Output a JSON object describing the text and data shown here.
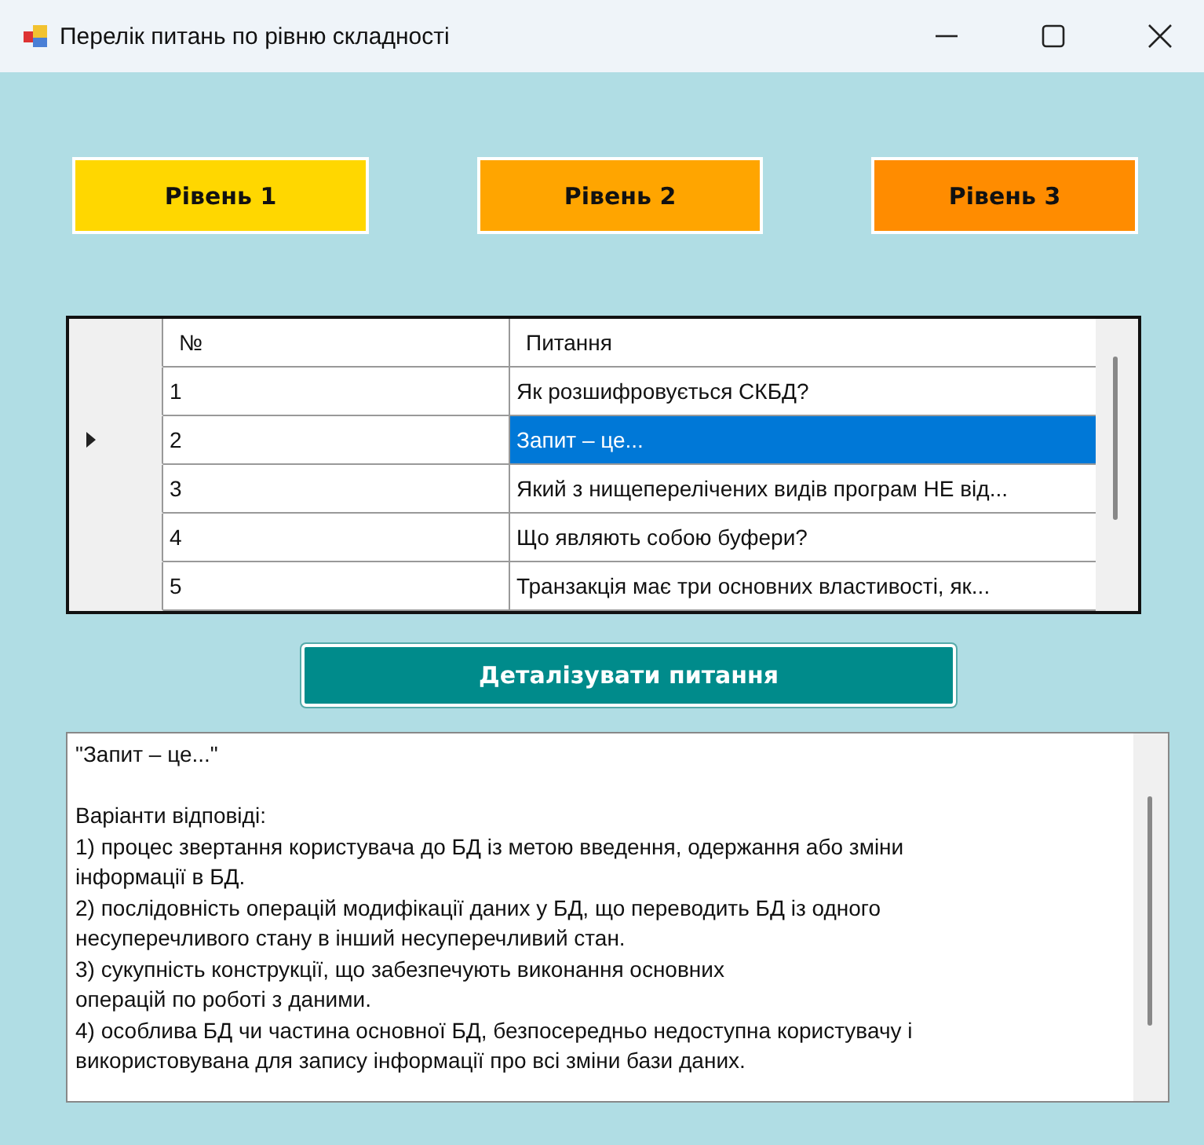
{
  "window": {
    "title": "Перелік питань по рівню складності"
  },
  "level_buttons": [
    {
      "label": "Рівень 1",
      "color": "#ffd700"
    },
    {
      "label": "Рівень 2",
      "color": "#ffa500"
    },
    {
      "label": "Рівень 3",
      "color": "#ff8c00"
    }
  ],
  "table": {
    "columns": [
      "№",
      "Питання"
    ],
    "rows": [
      {
        "number": "1",
        "question": "Як розшифровується СКБД?",
        "selected": false
      },
      {
        "number": "2",
        "question": "Запит – це...",
        "selected": true
      },
      {
        "number": "3",
        "question": "Який з нищеперелічених видів програм НЕ від...",
        "selected": false
      },
      {
        "number": "4",
        "question": "Що являють собою буфери?",
        "selected": false
      },
      {
        "number": "5",
        "question": "Транзакція має три основних властивості, як...",
        "selected": false
      }
    ]
  },
  "detail_button": {
    "label": "Деталізувати питання"
  },
  "details": {
    "paragraphs": [
      [
        "\"Запит – це...\""
      ],
      [
        "Варіанти відповіді:",
        "1) процес звертання користувача до БД із метою введення, одержання або зміни",
        "інформації в БД.",
        "2) послідовність операцій модифікації даних у БД, що переводить БД із одного",
        "несуперечливого стану в інший несуперечливий стан.",
        "3) сукупність конструкції, що забезпечують виконання основних",
        "операцій по роботі з даними.",
        "4) особлива БД чи частина основної БД, безпосередньо недоступна користувачу і",
        "використовувана для запису інформації про всі зміни бази даних."
      ]
    ]
  }
}
